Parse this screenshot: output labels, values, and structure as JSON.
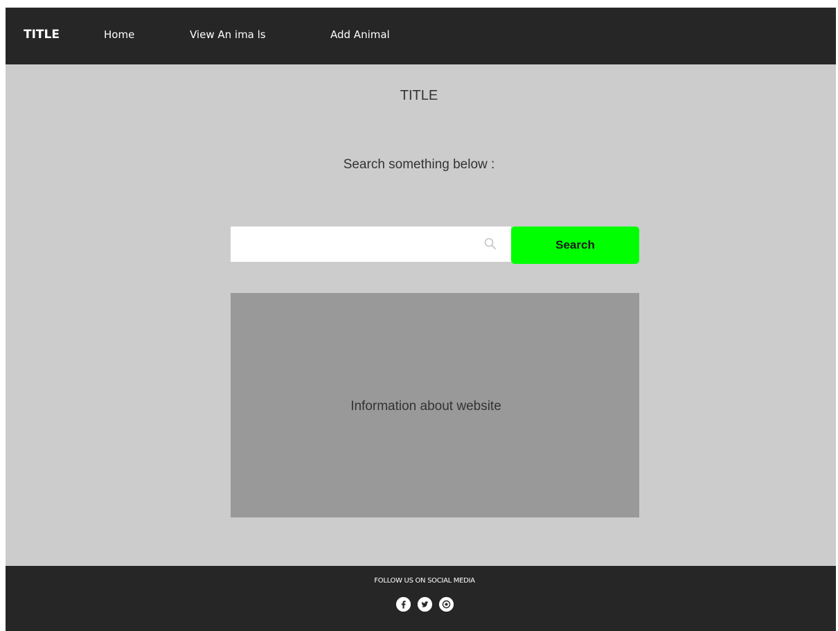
{
  "nav": {
    "brand": "TITLE",
    "links": [
      {
        "label": "Home"
      },
      {
        "label": "View An ima ls"
      },
      {
        "label": "Add Animal"
      }
    ]
  },
  "main": {
    "title": "TITLE",
    "prompt": "Search something below :",
    "search": {
      "value": "",
      "placeholder": "",
      "button_label": "Search"
    },
    "info_text": "Information about website"
  },
  "footer": {
    "follow_text": "FOLLOW US  ON SOCIAL MEDIA",
    "social_icons": [
      {
        "name": "facebook-icon",
        "glyph": "f"
      },
      {
        "name": "twitter-icon",
        "glyph": "t"
      },
      {
        "name": "pinterest-icon",
        "glyph": "p"
      }
    ]
  },
  "colors": {
    "nav_bg": "#262626",
    "page_bg": "#cccccc",
    "panel_bg": "#999999",
    "accent_button": "#00ff00"
  }
}
